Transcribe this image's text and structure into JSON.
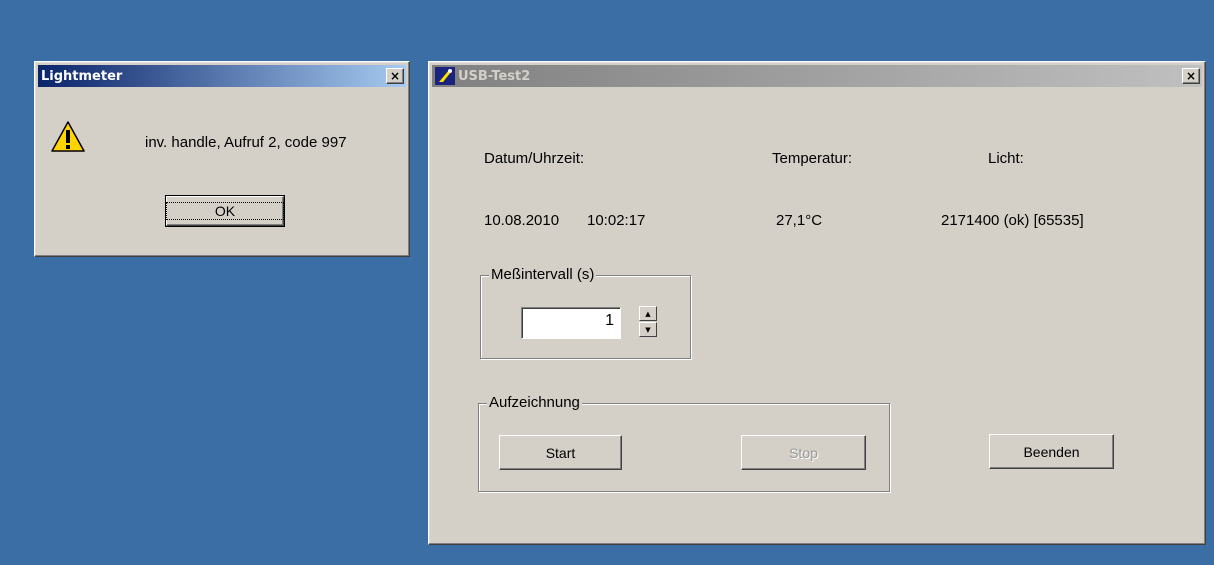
{
  "desktop": {
    "background_color": "#3a6ea5"
  },
  "lightmeter_dialog": {
    "title": "Lightmeter",
    "close_label": "×",
    "icon": "warning-icon",
    "message": "inv. handle, Aufruf 2, code 997",
    "ok_label": "OK"
  },
  "usb_window": {
    "title": "USB-Test2",
    "close_label": "×",
    "app_icon": "usb-app-icon",
    "headers": {
      "datetime": "Datum/Uhrzeit:",
      "temperature": "Temperatur:",
      "light": "Licht:"
    },
    "values": {
      "date": "10.08.2010",
      "time": "10:02:17",
      "temperature": "27,1°C",
      "light": "2171400 (ok) [65535]"
    },
    "interval_group": {
      "label": "Meßintervall (s)",
      "value": "1"
    },
    "recording_group": {
      "label": "Aufzeichnung",
      "start_label": "Start",
      "stop_label": "Stop"
    },
    "quit_label": "Beenden"
  }
}
